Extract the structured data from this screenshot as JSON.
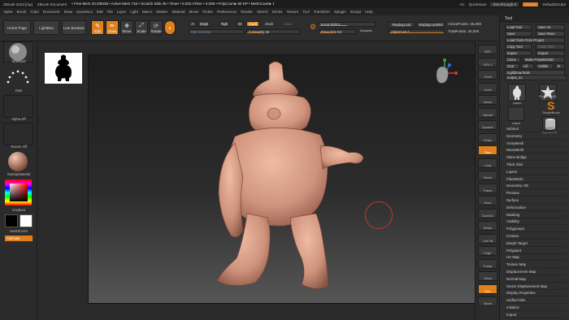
{
  "titlebar": {
    "app": "ZBrush 2023 [mµ]",
    "document": "ZBrush Document",
    "stats": "• Free Mem 20.036GB • Active Mem 716 • Scratch Disk 45 • Timer • 0.002 ATime • 0.008 • PolyCount▸ 50 KP • MeshCount▸ 1",
    "ac": "AC",
    "quicksave": "QuickSave",
    "seethrough": "See-through 0",
    "menus": "Menus",
    "script": "DefaultZScript"
  },
  "menubar": [
    "Alpha",
    "Brush",
    "Color",
    "Document",
    "Draw",
    "Dynamics",
    "Edit",
    "File",
    "Layer",
    "Light",
    "Macro",
    "Marker",
    "Material",
    "Movie",
    "Picker",
    "Preferences",
    "Render",
    "Stencil",
    "Stroke",
    "Texture",
    "Tool",
    "Transform",
    "Zplugin",
    "Zscript",
    "Help"
  ],
  "toolbar": {
    "home": "Home Page",
    "lightbox": "LightBox",
    "live_boolean": "Live Boolean",
    "edit": "Edit",
    "draw": "Draw",
    "move": "Move",
    "scale": "Scale",
    "rotate": "Rotate",
    "mrgb": "Mrgb",
    "rgb": "Rgb",
    "m": "M",
    "zadd": "Zadd",
    "zsub": "Zsub",
    "zcut": "Zcut",
    "a": "A",
    "rgb_intensity": "Rgb Intensity",
    "z_intensity": "Z Intensity 25",
    "focal_shift": "Focal Shift 0",
    "draw_size": "Draw Size 64",
    "dynamic": "Dynamic",
    "replay_last": "ReplayLast",
    "replay_last_rel": "ReplayLastRel",
    "adjust_last": "AdjustLast 1",
    "active_points": "ActivePoints: 25,000",
    "total_points": "TotalPoints: 25,000"
  },
  "leftshelf": {
    "standard": "Standard",
    "dots": "Dots",
    "alpha_off": "Alpha Off",
    "texture_off": "Texture Off",
    "material": "StartupMaterial",
    "gradient": "Gradient",
    "switch_color": "SwitchColor",
    "alternate": "Alternate"
  },
  "rightshelf": [
    "BPR",
    "SPix 3",
    "Scroll",
    "Zoom",
    "Actual",
    "AAHalf",
    "Dynamic",
    "Persp",
    "Floor",
    "Local",
    "Gizmo",
    "Frame",
    "Move",
    "Zoom3D",
    "Rotate",
    "Line Fill",
    "PolyF",
    "Transp",
    "Ghost",
    "Solo",
    "Xpose"
  ],
  "toolpanel": {
    "title": "Tool",
    "buttons": [
      "Load Tool",
      "Save As",
      "Save",
      "Save Rene",
      "Load Tools From Project",
      "Copy Tool",
      "Paste Tool",
      "Import",
      "Export",
      "Clone",
      "Make PolyMesh3D",
      "GoZ",
      "All",
      "Visible",
      "R",
      "Lightbox▸Tools"
    ],
    "subtool_name": "output_41",
    "thumbs": [
      "output",
      "PolyMesh3D",
      "SimpleBrush",
      "output",
      "Cylinder3D"
    ],
    "sections": [
      "Subtool",
      "Geometry",
      "ArrayMesh",
      "NanoMesh",
      "Slime Bridge",
      "Thick Skin",
      "Layers",
      "FiberMesh",
      "Geometry HD",
      "Preview",
      "Surface",
      "Deformation",
      "Masking",
      "Visibility",
      "Polygroups",
      "Contact",
      "Morph Target",
      "Polypaint",
      "UV Map",
      "Texture Map",
      "Displacement Map",
      "Normal Map",
      "Vector Displacement Map",
      "Display Properties",
      "Unified Skin",
      "Initialize",
      "Import"
    ]
  },
  "colors": {
    "accent": "#e0801c",
    "clay": "#cf937c",
    "canvas_top": "#1d1d1d"
  }
}
